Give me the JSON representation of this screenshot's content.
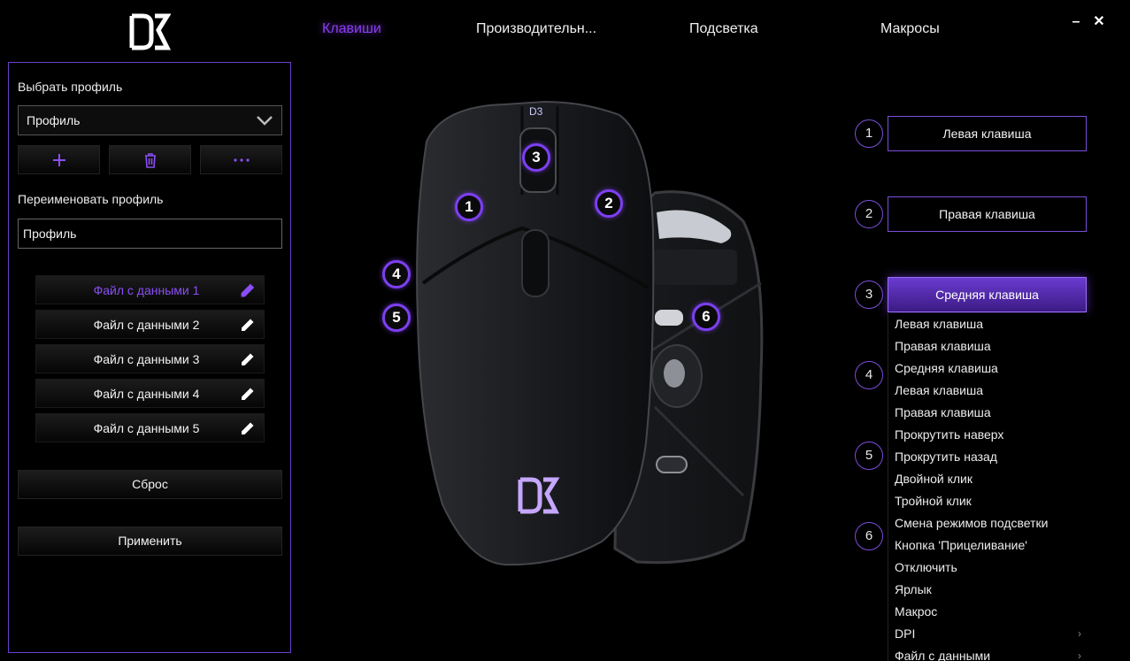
{
  "nav": {
    "tabs": [
      {
        "label": "Клавиши",
        "active": true
      },
      {
        "label": "Производительн..."
      },
      {
        "label": "Подсветка"
      },
      {
        "label": "Макросы"
      }
    ],
    "minimize_label": "–",
    "close_label": "✕"
  },
  "brand": {
    "accent": "#7c3ff0",
    "logo_text": "D3"
  },
  "left": {
    "select_profile_label": "Выбрать профиль",
    "profile_value": "Профиль",
    "rename_label": "Переименовать профиль",
    "rename_value": "Профиль",
    "files": [
      {
        "label": "Файл с данными 1",
        "active": true
      },
      {
        "label": "Файл с данными 2"
      },
      {
        "label": "Файл с данными 3"
      },
      {
        "label": "Файл с данными 4"
      },
      {
        "label": "Файл с данными 5"
      }
    ],
    "reset_label": "Сброс",
    "apply_label": "Применить"
  },
  "mouse_labels": [
    "1",
    "2",
    "3",
    "4",
    "5",
    "6"
  ],
  "right": {
    "numbers": [
      "1",
      "2",
      "3",
      "4",
      "5",
      "6"
    ],
    "buttons": [
      {
        "label": "Левая клавиша"
      },
      {
        "label": "Правая клавиша"
      },
      {
        "label": "Средняя клавиша",
        "active": true
      }
    ],
    "dropdown": [
      "Левая клавиша",
      "Правая клавиша",
      "Средняя клавиша",
      "Левая клавиша",
      "Правая клавиша",
      "Прокрутить наверх",
      "Прокрутить назад",
      "Двойной клик",
      "Тройной клик",
      "Смена режимов подсветки",
      "Кнопка 'Прицеливание'",
      "Отключить",
      "Ярлык",
      "Макрос",
      "DPI",
      "Файл с данными"
    ],
    "submenu_arrow": "›"
  }
}
